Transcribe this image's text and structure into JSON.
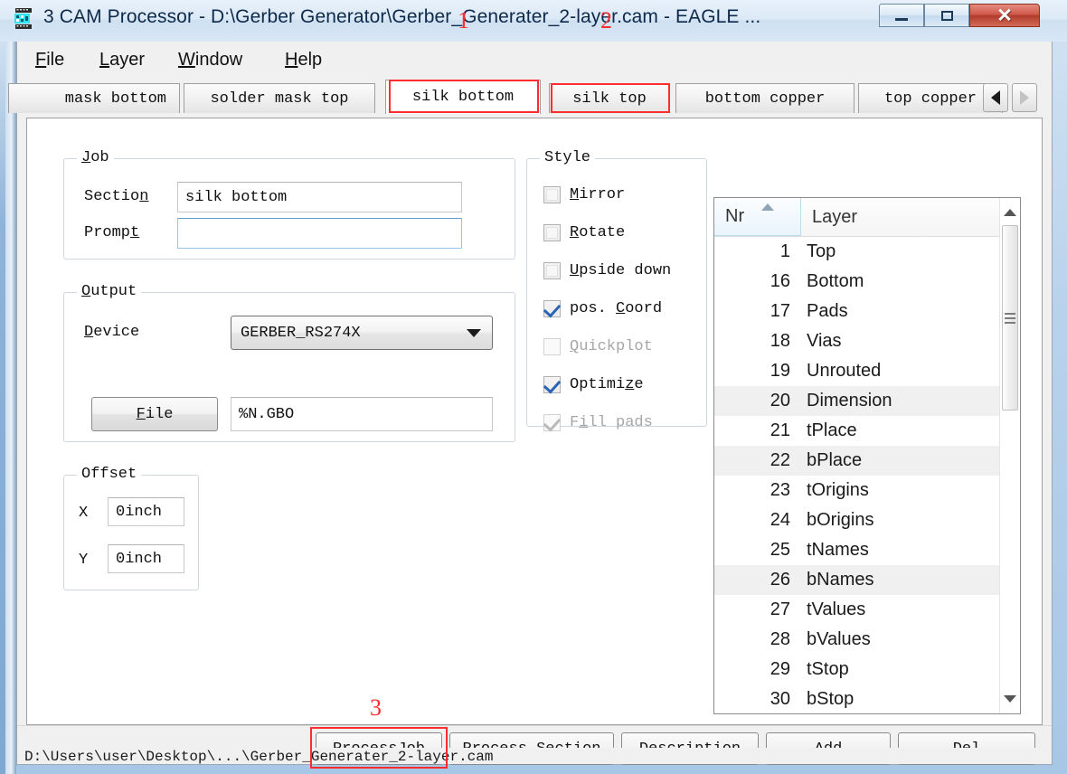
{
  "window": {
    "title": "3 CAM Processor - D:\\Gerber Generator\\Gerber_Generater_2-layer.cam - EAGLE ...",
    "icon": "cam-processor-icon",
    "minimize_label": "–",
    "maximize_label": "□",
    "close_label": "✕"
  },
  "menubar": {
    "items": [
      {
        "label": "File",
        "mnemonic": "F",
        "rest": "ile"
      },
      {
        "label": "Layer",
        "mnemonic": "L",
        "rest": "ayer"
      },
      {
        "label": "Window",
        "mnemonic": "W",
        "rest": "indow"
      },
      {
        "label": "Help",
        "mnemonic": "H",
        "rest": "elp"
      }
    ]
  },
  "tabs": {
    "items": [
      {
        "label": "mask bottom",
        "selected": false,
        "clipped": true
      },
      {
        "label": "solder mask top",
        "selected": false
      },
      {
        "label": "silk bottom",
        "selected": true
      },
      {
        "label": "silk top",
        "selected": false
      },
      {
        "label": "bottom copper",
        "selected": false
      },
      {
        "label": "top copper",
        "selected": false
      }
    ],
    "scroll_left_icon": "triangle-left-icon",
    "scroll_right_icon": "triangle-right-icon"
  },
  "annotations": [
    {
      "number": "1",
      "target": "silk bottom tab"
    },
    {
      "number": "2",
      "target": "silk top tab"
    },
    {
      "number": "3",
      "target": "Process Job button"
    }
  ],
  "job": {
    "group_title": "Job",
    "group_mnemonic": "J",
    "group_rest": "ob",
    "section_label": "Sectio",
    "section_label_mnemonic": "n",
    "section_value": "silk bottom",
    "prompt_label": "Promp",
    "prompt_label_mnemonic": "t",
    "prompt_value": ""
  },
  "output": {
    "group_mnemonic": "O",
    "group_rest": "utput",
    "device_label_mnemonic": "D",
    "device_label_rest": "evice",
    "device_value": "GERBER_RS274X",
    "file_button_label": "File",
    "file_button_mnemonic": "F",
    "file_value": "%N.GBO"
  },
  "offset": {
    "group_title": "Offset",
    "x_label": "X",
    "x_value": "0inch",
    "y_label": "Y",
    "y_value": "0inch"
  },
  "style": {
    "group_title": "Style",
    "items": [
      {
        "label": "Mirror",
        "mnemonic": "M",
        "rest": "irror",
        "checked": false,
        "enabled": true
      },
      {
        "label": "Rotate",
        "mnemonic": "R",
        "rest": "otate",
        "checked": false,
        "enabled": true
      },
      {
        "label": "Upside down",
        "mnemonic": "U",
        "rest": "pside down",
        "checked": false,
        "enabled": true
      },
      {
        "label": "pos. Coord",
        "pre": "pos. ",
        "mnemonic": "C",
        "rest": "oord",
        "checked": true,
        "enabled": true
      },
      {
        "label": "Quickplot",
        "mnemonic": "Q",
        "rest": "uickplot",
        "checked": false,
        "enabled": false
      },
      {
        "label": "Optimize",
        "pre": "Optimi",
        "mnemonic": "z",
        "rest": "e",
        "checked": true,
        "enabled": true
      },
      {
        "label": "Fill pads",
        "pre": "F",
        "mnemonic": "i",
        "rest": "ll pads",
        "checked": true,
        "enabled": false
      }
    ]
  },
  "layer_list": {
    "columns": [
      "Nr",
      "Layer"
    ],
    "sort_column": "Nr",
    "sort_direction": "asc",
    "rows": [
      {
        "nr": "1",
        "name": "Top",
        "selected": false
      },
      {
        "nr": "16",
        "name": "Bottom",
        "selected": false
      },
      {
        "nr": "17",
        "name": "Pads",
        "selected": false
      },
      {
        "nr": "18",
        "name": "Vias",
        "selected": false
      },
      {
        "nr": "19",
        "name": "Unrouted",
        "selected": false
      },
      {
        "nr": "20",
        "name": "Dimension",
        "selected": true
      },
      {
        "nr": "21",
        "name": "tPlace",
        "selected": false
      },
      {
        "nr": "22",
        "name": "bPlace",
        "selected": true
      },
      {
        "nr": "23",
        "name": "tOrigins",
        "selected": false
      },
      {
        "nr": "24",
        "name": "bOrigins",
        "selected": false
      },
      {
        "nr": "25",
        "name": "tNames",
        "selected": false
      },
      {
        "nr": "26",
        "name": "bNames",
        "selected": true
      },
      {
        "nr": "27",
        "name": "tValues",
        "selected": false
      },
      {
        "nr": "28",
        "name": "bValues",
        "selected": false
      },
      {
        "nr": "29",
        "name": "tStop",
        "selected": false
      },
      {
        "nr": "30",
        "name": "bStop",
        "selected": false
      }
    ],
    "scroll_up_icon": "triangle-up-icon",
    "scroll_down_icon": "triangle-down-icon"
  },
  "buttons": {
    "process_job": "Process Job",
    "process_job_pre": "Process ",
    "process_job_mnemonic": "J",
    "process_job_rest": "ob",
    "process_section_mnemonic": "P",
    "process_section_rest": "rocess Section",
    "description_mnemonic": "D",
    "description_rest": "escription",
    "add": "Add",
    "del": "Del"
  },
  "statusbar": {
    "text": "D:\\Users\\user\\Desktop\\...\\Gerber_Generater_2-layer.cam"
  },
  "colors": {
    "annotation_red": "#ff2d2d",
    "title_text": "#0d2a4a",
    "selection_gray": "#f0f0f0",
    "checkbox_blue": "#2a64b4"
  }
}
